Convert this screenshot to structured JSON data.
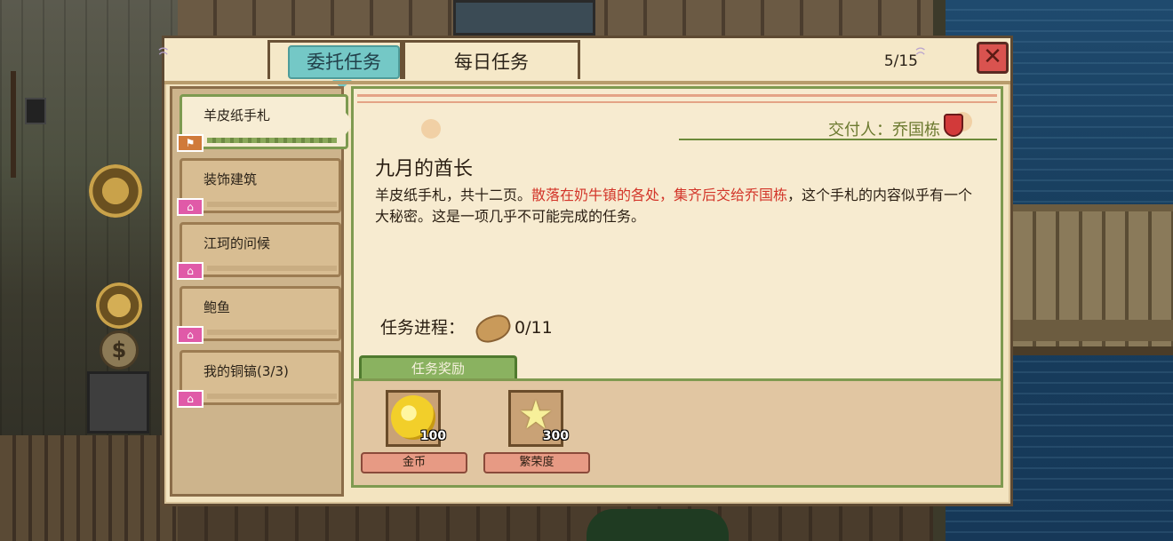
{
  "header": {
    "tabs": [
      {
        "label": "委托任务",
        "active": true
      },
      {
        "label": "每日任务",
        "active": false
      }
    ],
    "count": "5/15"
  },
  "quest_list": [
    {
      "label": "羊皮纸手札",
      "active": true,
      "tag_icon": "flag-icon"
    },
    {
      "label": "装饰建筑",
      "active": false,
      "tag_icon": "building-icon"
    },
    {
      "label": "江珂的问候",
      "active": false,
      "tag_icon": "building-icon"
    },
    {
      "label": "鲍鱼",
      "active": false,
      "tag_icon": "building-icon"
    },
    {
      "label": "我的铜镐(3/3)",
      "active": false,
      "tag_icon": "building-icon"
    }
  ],
  "detail": {
    "giver": "交付人：乔国栋",
    "title": "九月的酋长",
    "desc_part1": "羊皮纸手札，共十二页。",
    "desc_highlight": "散落在奶牛镇的各处，集齐后交给乔国栋",
    "desc_part2": "，这个手札的内容似乎有一个大秘密。这是一项几乎不可能完成的任务。",
    "progress_label": "任务进程：",
    "progress_value": "0/11",
    "progress_current": 0,
    "progress_total": 11
  },
  "rewards": {
    "tab_label": "任务奖励",
    "items": [
      {
        "name": "金币",
        "qty": "100",
        "icon": "gold-coin-icon"
      },
      {
        "name": "繁荣度",
        "qty": "300",
        "icon": "star-icon"
      }
    ]
  },
  "colors": {
    "active_tab": "#74c8c6",
    "highlight_text": "#d3362a",
    "reward_tab": "#8ab260",
    "close_button": "#d9534f"
  }
}
